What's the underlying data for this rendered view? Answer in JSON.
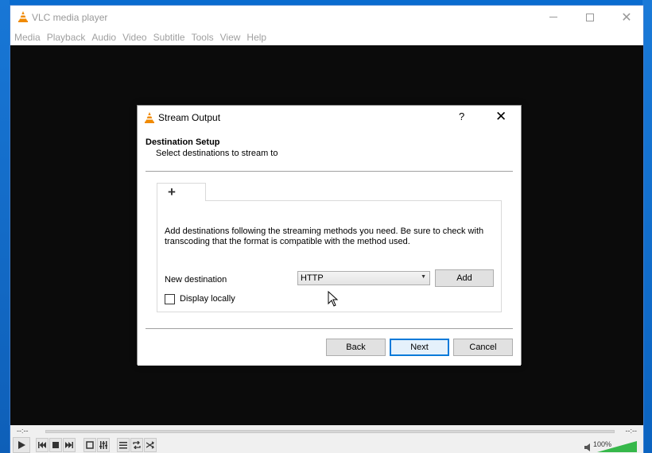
{
  "app": {
    "title": "VLC media player",
    "window_controls": {
      "minimize": "minimize",
      "maximize": "maximize",
      "close": "✕"
    }
  },
  "menu": [
    "Media",
    "Playback",
    "Audio",
    "Video",
    "Subtitle",
    "Tools",
    "View",
    "Help"
  ],
  "dialog": {
    "title": "Stream Output",
    "help": "?",
    "close": "✕",
    "heading": "Destination Setup",
    "subheading": "Select destinations to stream to",
    "tab_icon": "+",
    "description": "Add destinations following the streaming methods you need. Be sure to check with transcoding that the format is compatible with the method used.",
    "new_destination_label": "New destination",
    "destination_select": {
      "value": "HTTP"
    },
    "add_label": "Add",
    "display_locally_label": "Display locally",
    "display_locally_checked": false,
    "buttons": {
      "back": "Back",
      "next": "Next",
      "cancel": "Cancel"
    }
  },
  "controls": {
    "time_elapsed": "--:--",
    "time_total": "--:--",
    "volume": "100%"
  },
  "colors": {
    "desktop": "#0a6ccf",
    "video_bg": "#0b0b0b",
    "accent": "#0a7ad9",
    "vlc_orange": "#f08a00"
  },
  "icons": [
    "vlc-cone-icon",
    "plus-icon",
    "dropdown-caret-icon",
    "play-icon",
    "stop-icon",
    "speaker-icon",
    "mouse-cursor-icon"
  ]
}
